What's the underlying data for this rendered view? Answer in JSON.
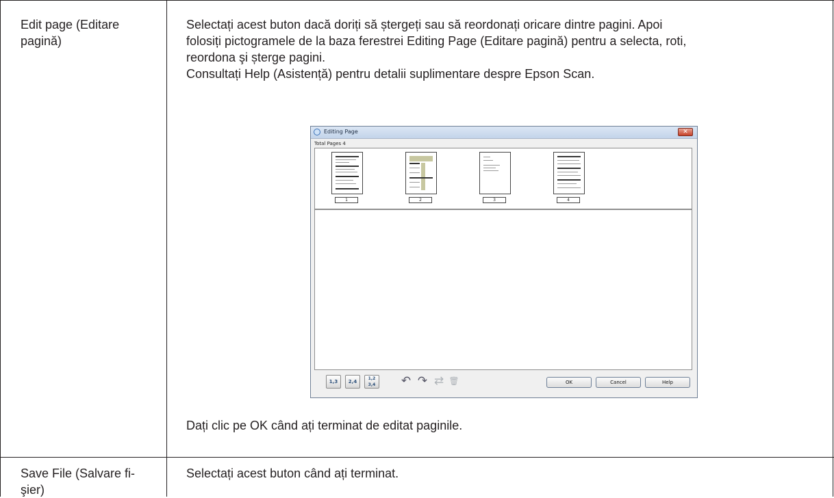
{
  "rows": [
    {
      "label": "Edit page (Editare pagină)",
      "label_lines": [
        "Edit page (Editare",
        "pagină)"
      ],
      "description_lines": [
        "Selectați acest buton dacă doriți să ștergeți sau să reordonați oricare dintre pagini. Apoi",
        "folosiți pictogramele de la baza ferestrei Editing Page (Editare pagină) pentru a selecta, roti,",
        "reordona şi șterge pagini.",
        "Consultați Help (Asistență) pentru detalii suplimentare despre Epson Scan."
      ],
      "after_screenshot": "Dați clic pe OK când ați terminat de editat paginile."
    },
    {
      "label": "Save File (Salvare fișier)",
      "label_lines": [
        "Save File (Salvare fi-",
        "şier)"
      ],
      "description_lines": [
        "Selectați acest buton când ați terminat."
      ]
    }
  ],
  "screenshot": {
    "title": "Editing Page",
    "close_icon": "✕",
    "total_pages": "Total Pages 4",
    "pages": [
      "1",
      "2",
      "3",
      "4"
    ],
    "toolbar_icons": [
      "select-odd-pages-icon",
      "select-even-pages-icon",
      "select-all-pages-icon",
      "rotate-left-icon",
      "rotate-right-icon",
      "reorder-icon",
      "delete-icon"
    ],
    "toolbar_icon_glyphs": [
      "1,3",
      "2,4",
      "1,2 3,4",
      "↶",
      "↷",
      "⇄",
      "🗑"
    ],
    "buttons": {
      "ok": "OK",
      "cancel": "Cancel",
      "help": "Help"
    }
  }
}
